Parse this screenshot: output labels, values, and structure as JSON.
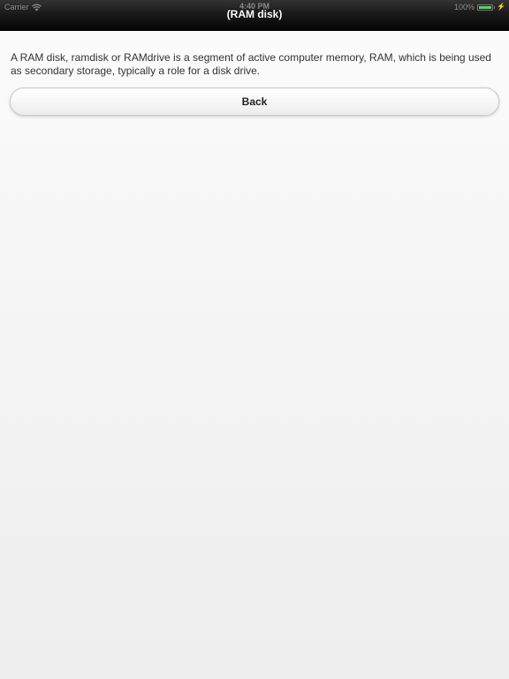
{
  "status_bar": {
    "carrier": "Carrier",
    "wifi_icon": "wifi-icon",
    "time": "4:40 PM",
    "battery_percent": "100%",
    "battery_level": 1.0,
    "battery_color": "#4cd964",
    "charging_icon": "bolt-icon"
  },
  "header": {
    "title": "(RAM disk)"
  },
  "main": {
    "description": "A RAM disk, ramdisk or RAMdrive is a segment of active computer memory, RAM, which is being used as secondary storage, typically a role for a disk drive.",
    "back_label": "Back"
  }
}
